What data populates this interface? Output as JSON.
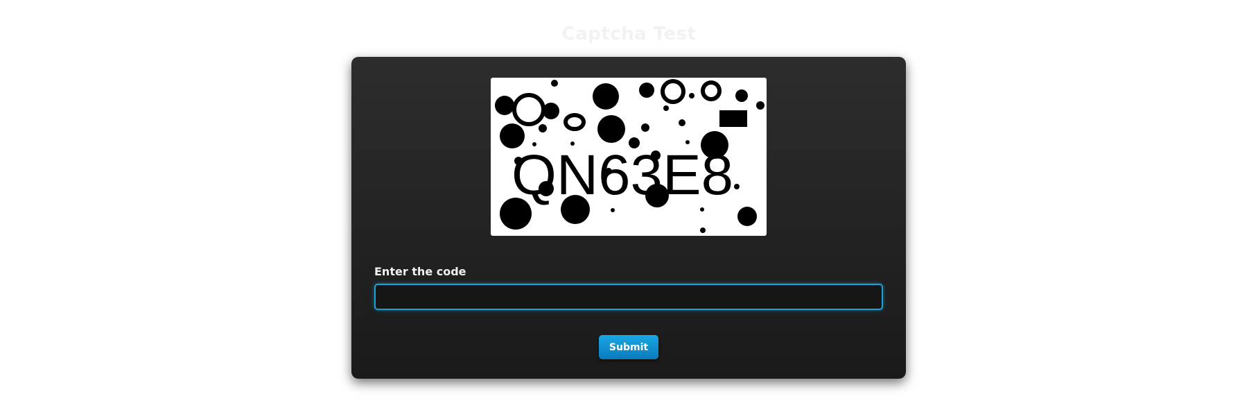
{
  "page": {
    "title": "Captcha Test"
  },
  "captcha": {
    "code": "QN63E8",
    "alt": "captcha image"
  },
  "form": {
    "label": "Enter the code",
    "input_value": "",
    "input_placeholder": "",
    "submit_label": "Submit"
  },
  "colors": {
    "card_background": "#222222",
    "accent": "#1ba3d8",
    "button": "#0a8fd0"
  }
}
